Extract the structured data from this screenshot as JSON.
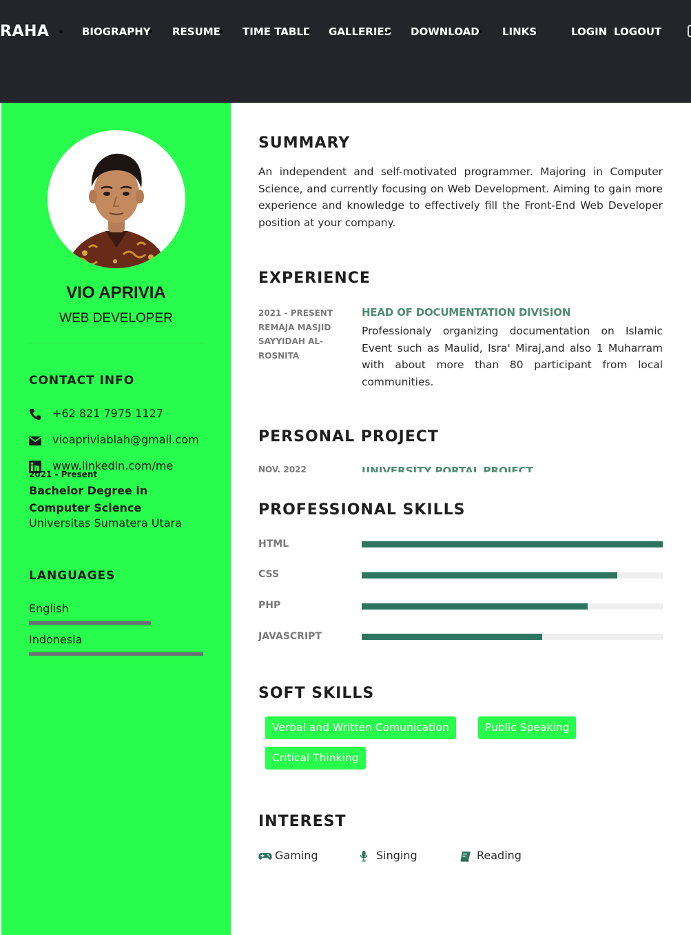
{
  "nav": {
    "brand": "RAHA",
    "items": [
      "BIOGRAPHY",
      "RESUME",
      "TIME TABLE",
      "GALLERIES",
      "DOWNLOAD",
      "LINKS"
    ],
    "login": "LOGIN",
    "logout": "LOGOUT"
  },
  "profile": {
    "name": "VIO APRIVIA",
    "title": "WEB DEVELOPER",
    "photo_alt": "profile-photo"
  },
  "contact": {
    "heading": "CONTACT INFO",
    "phone": "+62 821 7975 1127",
    "email": "vioapriviablah@gmail.com",
    "linkedin": "www.linkedin.com/me"
  },
  "education": {
    "date": "2021 - Present",
    "degree": "Bachelor Degree in Computer Science",
    "school": "Universitas Sumatera Utara"
  },
  "languages": {
    "heading": "LANGUAGES",
    "items": [
      {
        "name": "English",
        "level": 0.7
      },
      {
        "name": "Indonesia",
        "level": 1.0
      }
    ]
  },
  "summary": {
    "heading": "SUMMARY",
    "text": "An independent and self-motivated programmer. Majoring in Computer Science, and currently focusing on Web Development. Aiming to gain more experience and knowledge to effectively fill the Front-End Web Developer position at your company."
  },
  "experience": {
    "heading": "EXPERIENCE",
    "period": "2021 - PRESENT",
    "org": "REMAJA MASJID SAYYIDAH AL-ROSNITA",
    "role": "HEAD OF DOCUMENTATION DIVISION",
    "desc": "Professionaly organizing documentation on Islamic Event such as Maulid, Isra' Miraj,and also 1 Muharram with about more than 80 participant from local communities."
  },
  "project": {
    "heading": "PERSONAL PROJECT",
    "date": "NOV. 2022",
    "title": "UNIVERSITY PORTAL PROJECT"
  },
  "skills": {
    "heading": "PROFESSIONAL SKILLS",
    "items": [
      {
        "name": "HTML",
        "level": 1.0
      },
      {
        "name": "CSS",
        "level": 0.85
      },
      {
        "name": "PHP",
        "level": 0.75
      },
      {
        "name": "JAVASCRIPT",
        "level": 0.6
      }
    ]
  },
  "soft_skills": {
    "heading": "SOFT SKILLS",
    "items": [
      "Verbal and Written Comunication",
      "Public Speaking",
      "Critical Thinking"
    ]
  },
  "interest": {
    "heading": "INTEREST",
    "items": [
      "Gaming",
      "Singing",
      "Reading"
    ]
  },
  "colors": {
    "accent_green": "#28fc4c",
    "dark_green": "#2e7560",
    "nav_bg": "#23252b"
  }
}
